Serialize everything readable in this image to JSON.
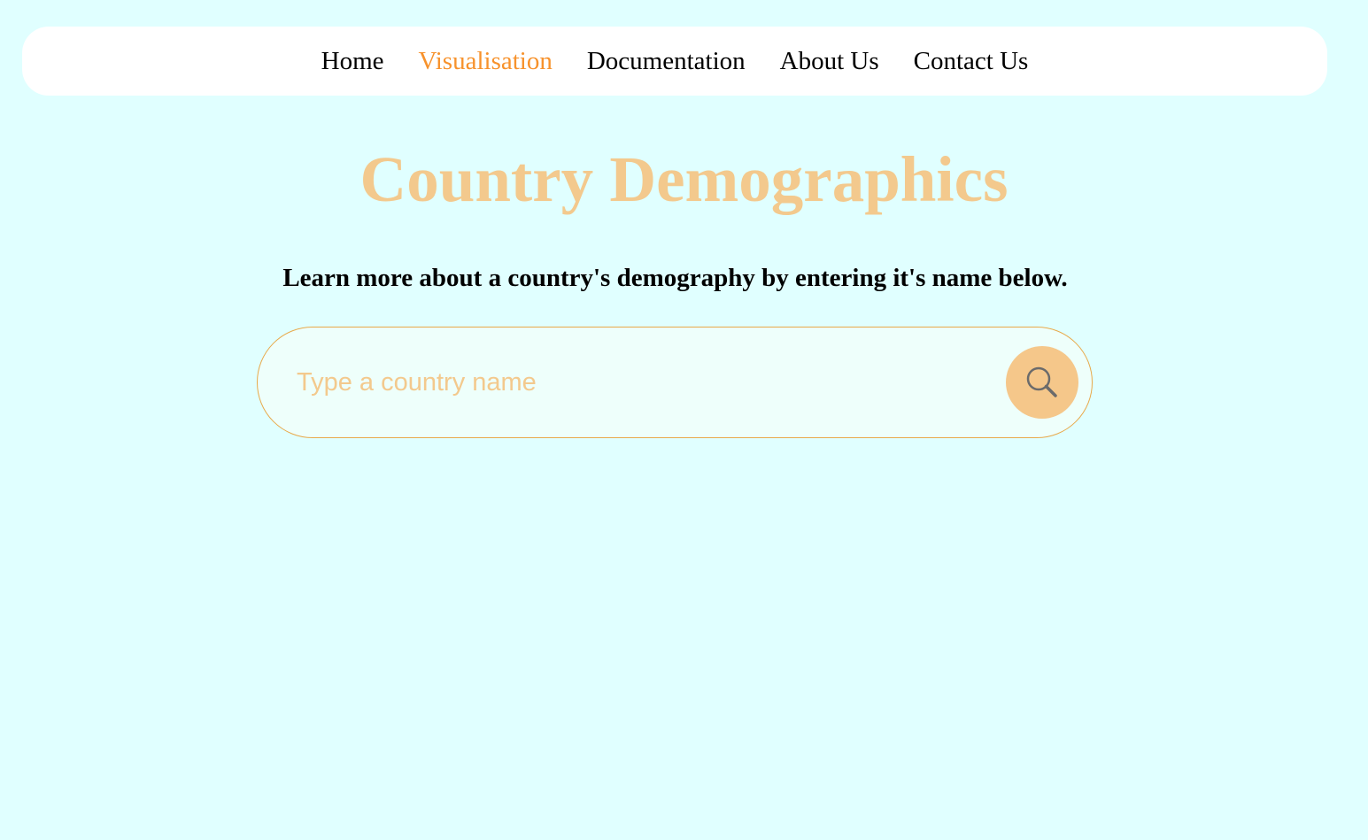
{
  "nav": {
    "items": [
      {
        "label": "Home",
        "active": false
      },
      {
        "label": "Visualisation",
        "active": true
      },
      {
        "label": "Documentation",
        "active": false
      },
      {
        "label": "About Us",
        "active": false
      },
      {
        "label": "Contact Us",
        "active": false
      }
    ]
  },
  "main": {
    "title": "Country Demographics",
    "subtitle": "Learn more about a country's demography by entering it's name below."
  },
  "search": {
    "placeholder": "Type a country name",
    "value": "",
    "button_icon": "search-icon"
  },
  "colors": {
    "background": "#e0ffff",
    "accent_active": "#f7922c",
    "title": "#f3c98d",
    "search_button": "#f5c78a",
    "search_border": "#e8a94a"
  }
}
